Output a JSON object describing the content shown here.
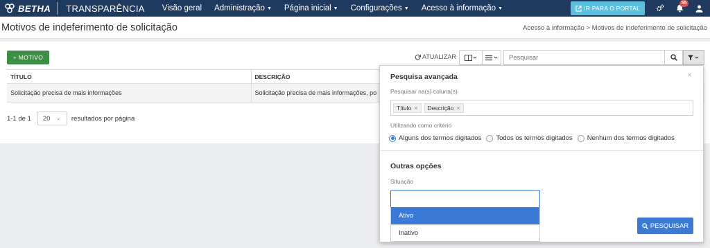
{
  "navbar": {
    "brand_name": "BETHA",
    "product": "TRANSPARÊNCIA",
    "menu": [
      {
        "label": "Visão geral",
        "has_caret": false
      },
      {
        "label": "Administração",
        "has_caret": true
      },
      {
        "label": "Página inicial",
        "has_caret": true
      },
      {
        "label": "Configurações",
        "has_caret": true
      },
      {
        "label": "Acesso à informação",
        "has_caret": true
      }
    ],
    "portal_button": "IR PARA O PORTAL",
    "notification_count": "55",
    "colors": {
      "bar": "#1f3a5f",
      "portal": "#5bc0de",
      "badge": "#d9534f"
    }
  },
  "page": {
    "title": "Motivos de indeferimento de solicitação",
    "breadcrumb": "Acesso à informação > Motivos de indeferimento de solicitação"
  },
  "toolbar": {
    "add_label": "+ MOTIVO",
    "refresh_label": "ATUALIZAR",
    "search_placeholder": "Pesquisar",
    "icons": [
      "refresh-icon",
      "columns-icon",
      "list-icon",
      "search-icon",
      "filter-icon"
    ]
  },
  "table": {
    "headers": [
      "TÍTULO",
      "DESCRIÇÃO"
    ],
    "rows": [
      [
        "Solicitação precisa de mais informações",
        "Solicitação precisa de mais informações, po"
      ]
    ]
  },
  "pagination": {
    "range": "1-1 de 1",
    "page_size": "20",
    "label": "resultados por página"
  },
  "advanced_search": {
    "title": "Pesquisa avançada",
    "columns_label": "Pesquisar na(s) coluna(s)",
    "columns": [
      "Título",
      "Descrição"
    ],
    "criteria_label": "Utilizando como critério",
    "criteria_options": [
      {
        "label": "Alguns dos termos digitados",
        "checked": true
      },
      {
        "label": "Todos os termos digitados",
        "checked": false
      },
      {
        "label": "Nenhum dos termos digitados",
        "checked": false
      }
    ],
    "other_options_title": "Outras opções",
    "situacao_label": "Situação",
    "situacao_options": [
      {
        "label": "Ativo",
        "highlighted": true
      },
      {
        "label": "Inativo",
        "highlighted": false
      }
    ],
    "search_button": "PESQUISAR",
    "colors": {
      "primary": "#3c7bd3",
      "add_button": "#3e8e48"
    }
  }
}
